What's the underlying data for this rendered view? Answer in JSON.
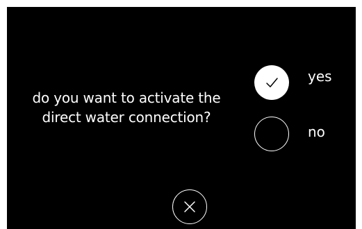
{
  "dialog": {
    "question": "do you want to activate the direct water connection?",
    "options": [
      {
        "label": "yes",
        "selected": true
      },
      {
        "label": "no",
        "selected": false
      }
    ]
  },
  "icons": {
    "selected_option": "checkmark-icon",
    "close": "close-icon"
  },
  "colors": {
    "background": "#000000",
    "foreground": "#ffffff",
    "checkmark": "#000000"
  }
}
